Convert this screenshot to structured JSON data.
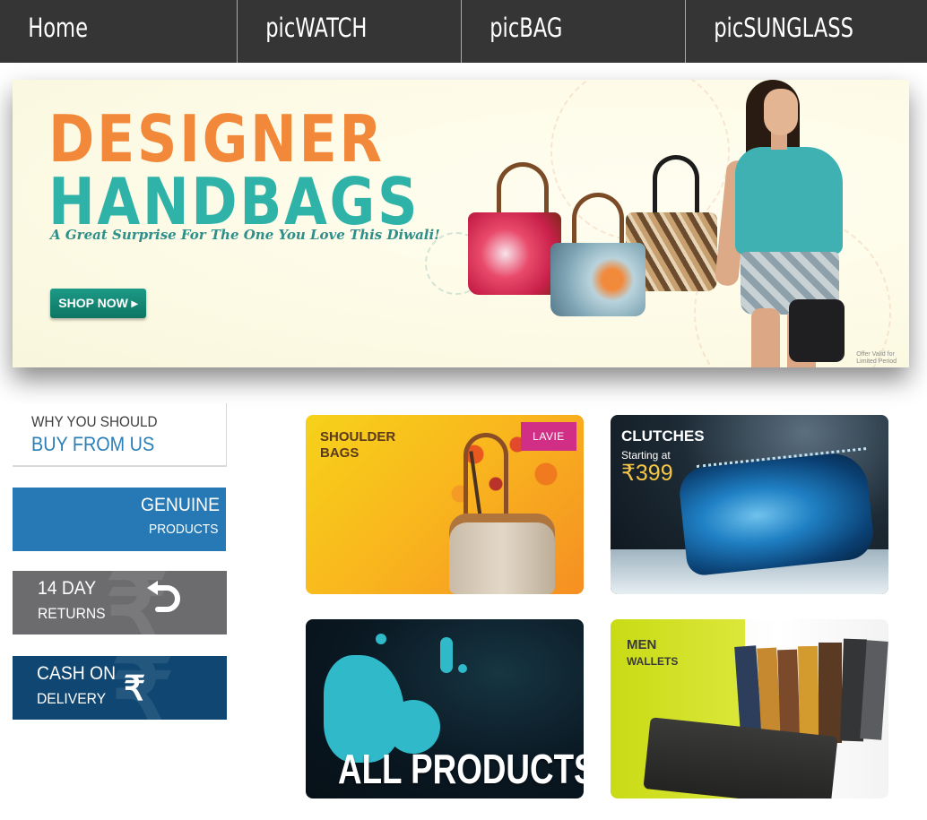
{
  "nav": {
    "items": [
      {
        "label": "Home"
      },
      {
        "label": "picWATCH"
      },
      {
        "label": "picBAG"
      },
      {
        "label": "picSUNGLASS"
      }
    ]
  },
  "banner": {
    "title_line1": "DESIGNER",
    "title_line2": "HANDBAGS",
    "tagline": "A Great Surprise For The One You Love This Diwali!",
    "cta_label": "SHOP NOW ▸",
    "offer_note_line1": "Offer Valid for",
    "offer_note_line2": "Limited Period",
    "colors": {
      "title1": "#f2893a",
      "title2": "#2fb3a9",
      "cta": "#0d7563"
    }
  },
  "why": {
    "line1": "WHY YOU SHOULD",
    "line2": "BUY FROM US"
  },
  "features": [
    {
      "big": "GENUINE",
      "small": "PRODUCTS",
      "icon": "none",
      "color": "#2779b5"
    },
    {
      "big": "14 DAY",
      "small": "RETURNS",
      "icon": "return-arrow-icon",
      "color": "#6c6c6e"
    },
    {
      "big": "CASH ON",
      "small": "DELIVERY",
      "icon": "rupee-icon",
      "color": "#0f4772"
    }
  ],
  "tiles": {
    "shoulder": {
      "line1": "SHOULDER",
      "line2": "BAGS",
      "brand": "LAVIE"
    },
    "clutches": {
      "title": "CLUTCHES",
      "subtitle": "Starting at",
      "price": "₹399"
    },
    "all": {
      "title": "ALL PRODUCTS"
    },
    "wallets": {
      "line1": "MEN",
      "line2": "WALLETS"
    }
  }
}
